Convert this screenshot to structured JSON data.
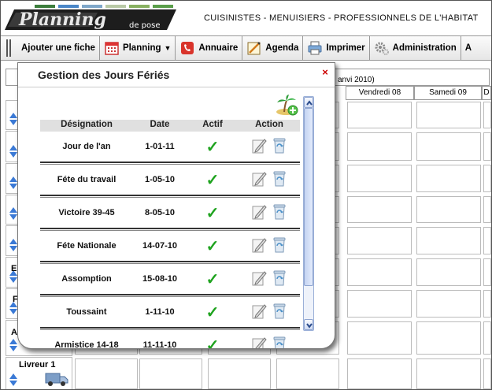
{
  "header": {
    "logo_text": "Planning de pose",
    "tagline": "CUISINISTES - MENUISIERS - PROFESSIONNELS DE L'HABITAT"
  },
  "menu": {
    "items": [
      {
        "label": "Ajouter une fiche",
        "icon": "none"
      },
      {
        "label": "Planning",
        "icon": "calendar-icon"
      },
      {
        "label": "Annuaire",
        "icon": "phone-book-icon"
      },
      {
        "label": "Agenda",
        "icon": "agenda-icon"
      },
      {
        "label": "Imprimer",
        "icon": "printer-icon"
      },
      {
        "label": "Administration",
        "icon": "gears-icon"
      },
      {
        "label": "A",
        "icon": "none"
      }
    ]
  },
  "grid": {
    "week_fragment": "anvi 2010)",
    "columns": [
      "Vendredi 08",
      "Samedi 09",
      "D"
    ],
    "row_labels": [
      "E",
      "F",
      "A",
      "Livreur 1"
    ]
  },
  "modal": {
    "title": "Gestion des Jours Fériés",
    "close": "×",
    "table": {
      "headers": [
        "Désignation",
        "Date",
        "Actif",
        "Action"
      ],
      "rows": [
        {
          "designation": "Jour de l'an",
          "date": "1-01-11",
          "actif": "✓"
        },
        {
          "designation": "Féte du travail",
          "date": "1-05-10",
          "actif": "✓"
        },
        {
          "designation": "Victoire 39-45",
          "date": "8-05-10",
          "actif": "✓"
        },
        {
          "designation": "Féte Nationale",
          "date": "14-07-10",
          "actif": "✓"
        },
        {
          "designation": "Assomption",
          "date": "15-08-10",
          "actif": "✓"
        },
        {
          "designation": "Toussaint",
          "date": "1-11-10",
          "actif": "✓"
        },
        {
          "designation": "Armistice 14-18",
          "date": "11-11-10",
          "actif": "✓"
        }
      ]
    }
  },
  "colors": {
    "check": "#1fa31f",
    "close": "#cc0000",
    "arrow": "#3b7ad6"
  }
}
